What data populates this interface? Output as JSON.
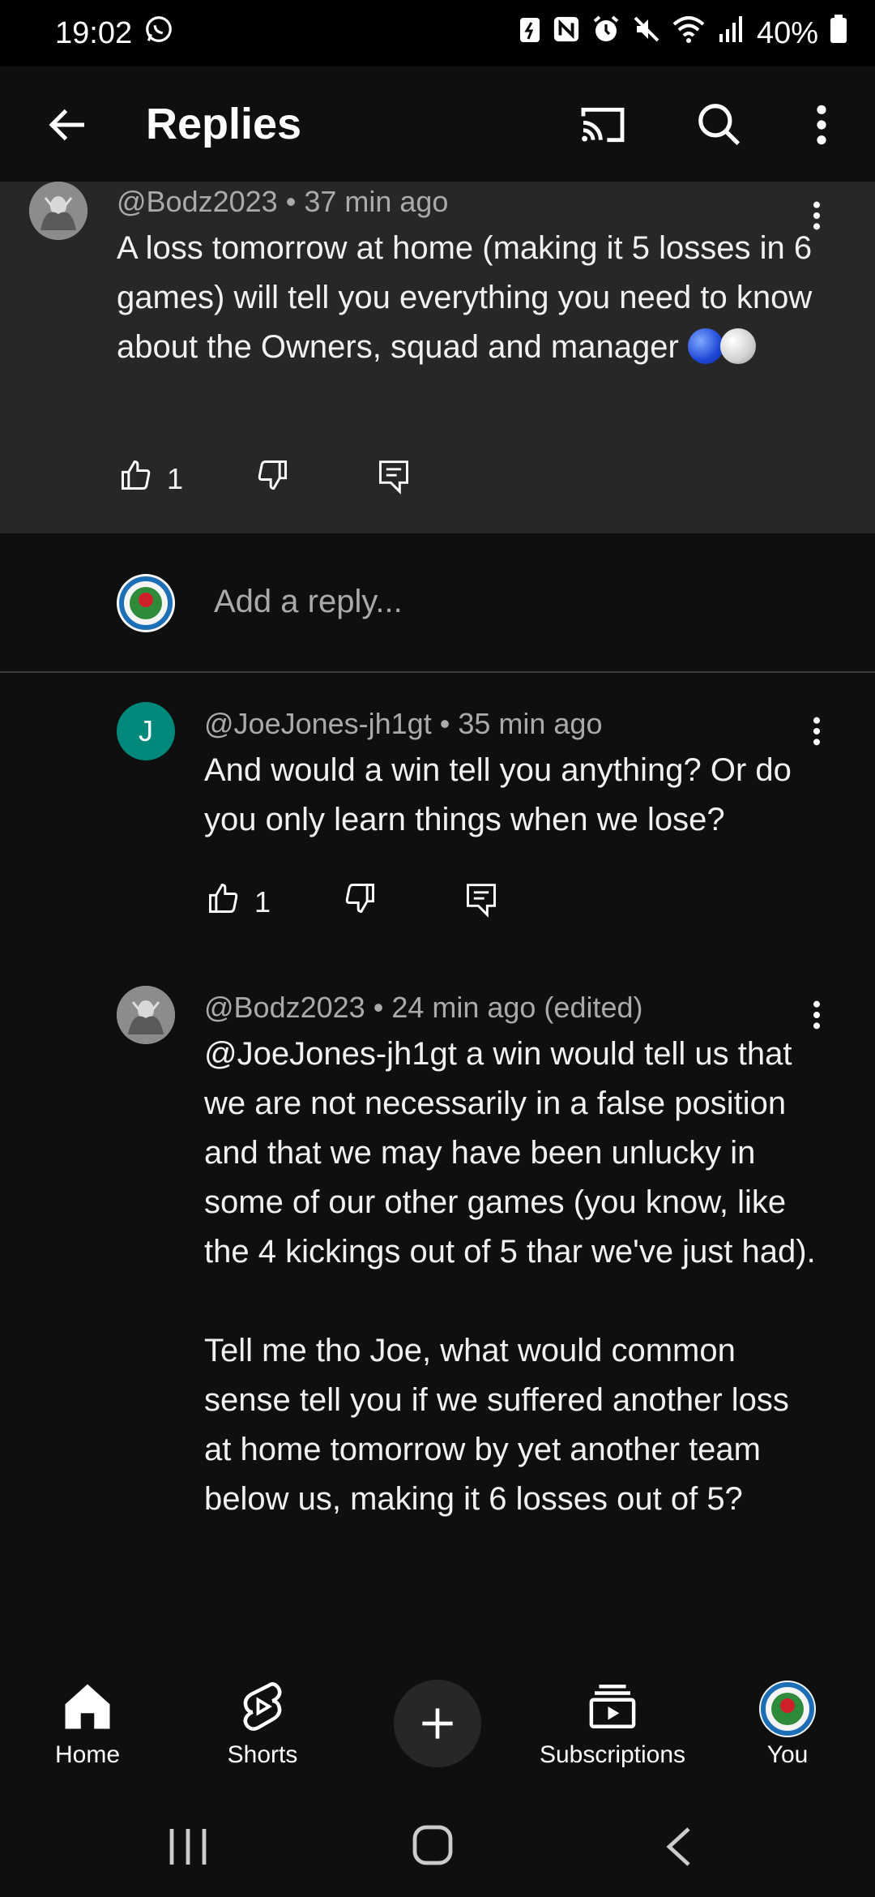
{
  "status_bar": {
    "time": "19:02",
    "battery": "40%",
    "icons": [
      "whatsapp-icon",
      "battery-saver-icon",
      "nfc-icon",
      "alarm-icon",
      "mute-icon",
      "wifi-icon",
      "signal-icon",
      "battery-icon"
    ]
  },
  "app_bar": {
    "title": "Replies",
    "back_icon": "back-arrow-icon",
    "cast_icon": "cast-icon",
    "search_icon": "search-icon",
    "more_icon": "more-vert-icon"
  },
  "parent_comment": {
    "author": "@Bodz2023",
    "time": "37 min ago",
    "text": "A loss tomorrow at home (making it 5 losses in 6 games) will tell you everything you need to know about the Owners, squad and manager",
    "emoji": "🔵⚪",
    "likes": "1"
  },
  "reply_box": {
    "placeholder": "Add a reply..."
  },
  "replies": [
    {
      "author": "@JoeJones-jh1gt",
      "time": "35 min ago",
      "avatar_letter": "J",
      "avatar_color": "#00897b",
      "text": "And would a win tell you anything? Or do you only learn things when we lose?",
      "likes": "1"
    },
    {
      "author": "@Bodz2023",
      "time": "24 min ago (edited)",
      "text_p1": "@JoeJones-jh1gt  a win would tell us that we are not necessarily in a false position and that we may have been unlucky in some of our other games (you know, like the 4 kickings out of 5 thar we've just had).",
      "text_p2": "Tell me tho Joe, what would common sense tell you if we suffered another loss at home tomorrow by yet another team below us, making it 6 losses out of 5?"
    }
  ],
  "bottom_nav": {
    "home": "Home",
    "shorts": "Shorts",
    "subscriptions": "Subscriptions",
    "you": "You"
  },
  "colors": {
    "background": "#0f0f0f",
    "parent_bg": "#272727",
    "text": "#f1f1f1",
    "secondary_text": "#aaaaaa"
  }
}
